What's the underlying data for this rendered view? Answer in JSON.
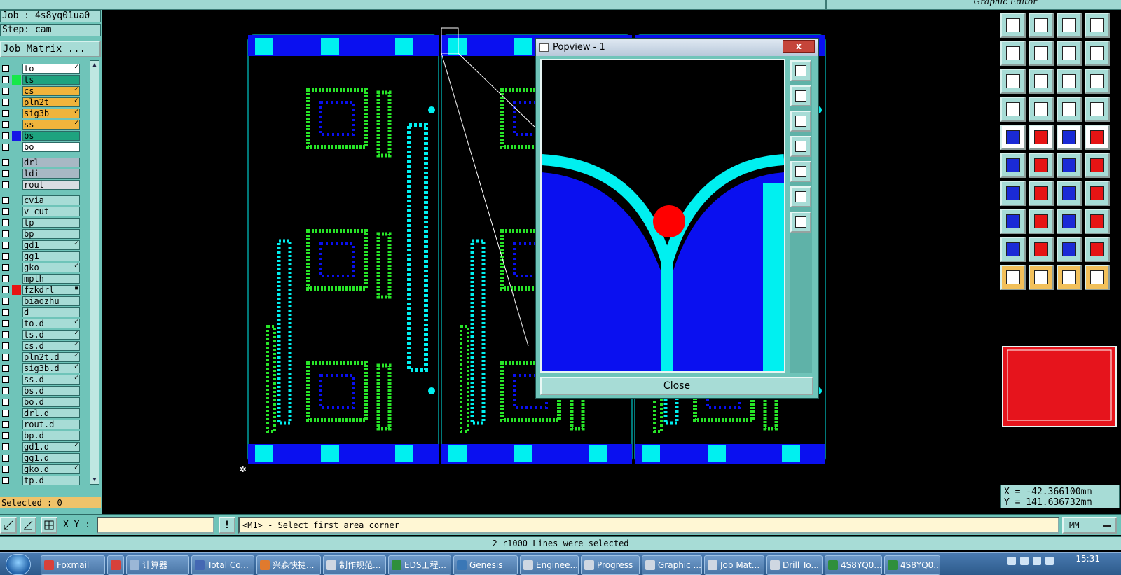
{
  "window": {
    "title": "Graphic Editor"
  },
  "job": {
    "name_line": "Job : 4s8yq01ua0",
    "step_line": "Step: cam",
    "matrix_button": "Job Matrix ..."
  },
  "layers": [
    {
      "name": "to",
      "color": "#ffffff",
      "swatch": "",
      "mark": "✓",
      "group": 1
    },
    {
      "name": "ts",
      "color": "#1ea37f",
      "swatch": "#16e84a",
      "mark": "",
      "group": 1
    },
    {
      "name": "cs",
      "color": "#f0b43c",
      "swatch": "",
      "mark": "✓",
      "group": 1
    },
    {
      "name": "pln2t",
      "color": "#f0b43c",
      "swatch": "",
      "mark": "✓",
      "group": 1
    },
    {
      "name": "sig3b",
      "color": "#f0b43c",
      "swatch": "",
      "mark": "✓",
      "group": 1
    },
    {
      "name": "ss",
      "color": "#f0b43c",
      "swatch": "",
      "mark": "✓",
      "group": 1
    },
    {
      "name": "bs",
      "color": "#1ea37f",
      "swatch": "#1616e6",
      "mark": "",
      "group": 1
    },
    {
      "name": "bo",
      "color": "#ffffff",
      "swatch": "",
      "mark": "",
      "group": 1
    },
    {
      "name": "drl",
      "color": "#a8b8c4",
      "swatch": "",
      "mark": "",
      "group": 2
    },
    {
      "name": "ldi",
      "color": "#a8b8c4",
      "swatch": "",
      "mark": "",
      "group": 2
    },
    {
      "name": "rout",
      "color": "#d8dde2",
      "swatch": "",
      "mark": "",
      "group": 2
    },
    {
      "name": "cvia",
      "color": "#a7dcd6",
      "swatch": "",
      "mark": "",
      "group": 3
    },
    {
      "name": "v-cut",
      "color": "#a7dcd6",
      "swatch": "",
      "mark": "",
      "group": 3
    },
    {
      "name": "tp",
      "color": "#a7dcd6",
      "swatch": "",
      "mark": "",
      "group": 3
    },
    {
      "name": "bp",
      "color": "#a7dcd6",
      "swatch": "",
      "mark": "",
      "group": 3
    },
    {
      "name": "gd1",
      "color": "#a7dcd6",
      "swatch": "",
      "mark": "✓",
      "group": 3
    },
    {
      "name": "gg1",
      "color": "#a7dcd6",
      "swatch": "",
      "mark": "",
      "group": 3
    },
    {
      "name": "gko",
      "color": "#a7dcd6",
      "swatch": "",
      "mark": "✓",
      "group": 3
    },
    {
      "name": "mpth",
      "color": "#a7dcd6",
      "swatch": "",
      "mark": "",
      "group": 3
    },
    {
      "name": "fzkdrl",
      "color": "#a7dcd6",
      "swatch": "#e61414",
      "mark": "▪",
      "group": 3
    },
    {
      "name": "biaozhu",
      "color": "#a7dcd6",
      "swatch": "",
      "mark": "",
      "group": 3
    },
    {
      "name": "d",
      "color": "#a7dcd6",
      "swatch": "",
      "mark": "",
      "group": 3
    },
    {
      "name": "to.d",
      "color": "#a7dcd6",
      "swatch": "",
      "mark": "✓",
      "group": 3
    },
    {
      "name": "ts.d",
      "color": "#a7dcd6",
      "swatch": "",
      "mark": "✓",
      "group": 3
    },
    {
      "name": "cs.d",
      "color": "#a7dcd6",
      "swatch": "",
      "mark": "✓",
      "group": 3
    },
    {
      "name": "pln2t.d",
      "color": "#a7dcd6",
      "swatch": "",
      "mark": "✓",
      "group": 3
    },
    {
      "name": "sig3b.d",
      "color": "#a7dcd6",
      "swatch": "",
      "mark": "✓",
      "group": 3
    },
    {
      "name": "ss.d",
      "color": "#a7dcd6",
      "swatch": "",
      "mark": "✓",
      "group": 3
    },
    {
      "name": "bs.d",
      "color": "#a7dcd6",
      "swatch": "",
      "mark": "",
      "group": 3
    },
    {
      "name": "bo.d",
      "color": "#a7dcd6",
      "swatch": "",
      "mark": "",
      "group": 3
    },
    {
      "name": "drl.d",
      "color": "#a7dcd6",
      "swatch": "",
      "mark": "",
      "group": 3
    },
    {
      "name": "rout.d",
      "color": "#a7dcd6",
      "swatch": "",
      "mark": "",
      "group": 3
    },
    {
      "name": "bp.d",
      "color": "#a7dcd6",
      "swatch": "",
      "mark": "",
      "group": 3
    },
    {
      "name": "gd1.d",
      "color": "#a7dcd6",
      "swatch": "",
      "mark": "✓",
      "group": 3
    },
    {
      "name": "gg1.d",
      "color": "#a7dcd6",
      "swatch": "",
      "mark": "",
      "group": 3
    },
    {
      "name": "gko.d",
      "color": "#a7dcd6",
      "swatch": "",
      "mark": "✓",
      "group": 3
    },
    {
      "name": "tp.d",
      "color": "#a7dcd6",
      "swatch": "",
      "mark": "",
      "group": 3
    }
  ],
  "selected": "Selected : 0",
  "popview": {
    "title": "Popview - 1",
    "close_label": "Close",
    "close_x": "x"
  },
  "coords": {
    "x": "X = -42.366100mm",
    "y": "Y = 141.636732mm"
  },
  "command": {
    "xy_label": "X Y :",
    "xy_value": "",
    "excl": "!",
    "prompt": "<M1> - Select first area corner",
    "units": "MM"
  },
  "status": "2 r1000 Lines were selected",
  "taskbar": {
    "items": [
      {
        "label": "Foxmail",
        "icon": "#d8413a"
      },
      {
        "label": "",
        "icon": "#d8413a"
      },
      {
        "label": "计算器",
        "icon": "#9bb7d6"
      },
      {
        "label": "Total Co...",
        "icon": "#4468b3"
      },
      {
        "label": "兴森快捷...",
        "icon": "#e07a2e"
      },
      {
        "label": "制作规范...",
        "icon": "#cfd7e2"
      },
      {
        "label": "EDS工程...",
        "icon": "#2f8f3c"
      },
      {
        "label": "Genesis",
        "icon": "#3a77b6"
      },
      {
        "label": "Enginee...",
        "icon": "#cfd7e2"
      },
      {
        "label": "Progress",
        "icon": "#cfd7e2"
      },
      {
        "label": "Graphic ...",
        "icon": "#cfd7e2"
      },
      {
        "label": "Job Mat...",
        "icon": "#cfd7e2"
      },
      {
        "label": "Drill To...",
        "icon": "#cfd7e2"
      },
      {
        "label": "4S8YQ0...",
        "icon": "#2f8f3c"
      },
      {
        "label": "4S8YQ0...",
        "icon": "#2f8f3c"
      }
    ],
    "clock": "15:31"
  },
  "colors": {
    "panel": "#6fc4b9",
    "cyan": "#00f0f0",
    "blue": "#0a10f0",
    "green": "#28e628",
    "red": "#e61414"
  }
}
